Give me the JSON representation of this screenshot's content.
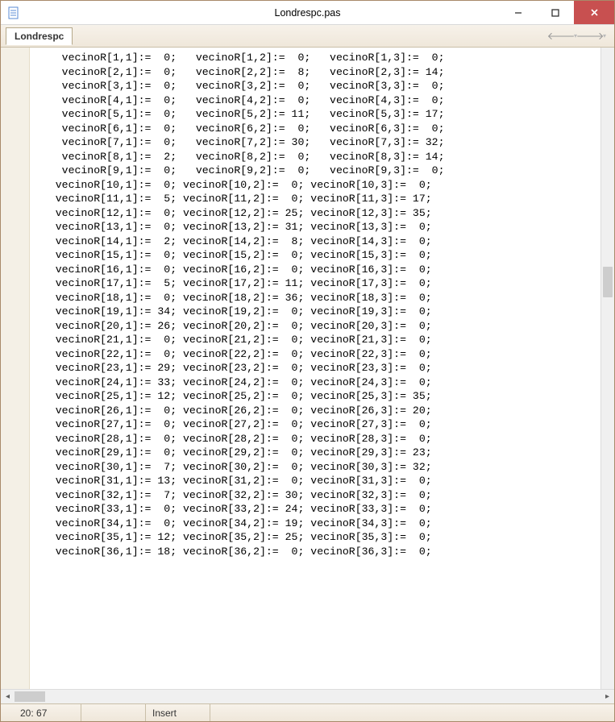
{
  "window": {
    "title": "Londrespc.pas"
  },
  "tab": {
    "label": "Londrespc"
  },
  "status": {
    "position": "20: 67",
    "mode": "Insert"
  },
  "code": {
    "indent": "   ",
    "rows": [
      {
        "i": 1,
        "a": 0,
        "b": 0,
        "c": 0
      },
      {
        "i": 2,
        "a": 0,
        "b": 8,
        "c": 14
      },
      {
        "i": 3,
        "a": 0,
        "b": 0,
        "c": 0
      },
      {
        "i": 4,
        "a": 0,
        "b": 0,
        "c": 0
      },
      {
        "i": 5,
        "a": 0,
        "b": 11,
        "c": 17
      },
      {
        "i": 6,
        "a": 0,
        "b": 0,
        "c": 0
      },
      {
        "i": 7,
        "a": 0,
        "b": 30,
        "c": 32
      },
      {
        "i": 8,
        "a": 2,
        "b": 0,
        "c": 14
      },
      {
        "i": 9,
        "a": 0,
        "b": 0,
        "c": 0
      },
      {
        "i": 10,
        "a": 0,
        "b": 0,
        "c": 0
      },
      {
        "i": 11,
        "a": 5,
        "b": 0,
        "c": 17
      },
      {
        "i": 12,
        "a": 0,
        "b": 25,
        "c": 35
      },
      {
        "i": 13,
        "a": 0,
        "b": 31,
        "c": 0
      },
      {
        "i": 14,
        "a": 2,
        "b": 8,
        "c": 0
      },
      {
        "i": 15,
        "a": 0,
        "b": 0,
        "c": 0
      },
      {
        "i": 16,
        "a": 0,
        "b": 0,
        "c": 0
      },
      {
        "i": 17,
        "a": 5,
        "b": 11,
        "c": 0
      },
      {
        "i": 18,
        "a": 0,
        "b": 36,
        "c": 0
      },
      {
        "i": 19,
        "a": 34,
        "b": 0,
        "c": 0
      },
      {
        "i": 20,
        "a": 26,
        "b": 0,
        "c": 0
      },
      {
        "i": 21,
        "a": 0,
        "b": 0,
        "c": 0
      },
      {
        "i": 22,
        "a": 0,
        "b": 0,
        "c": 0
      },
      {
        "i": 23,
        "a": 29,
        "b": 0,
        "c": 0
      },
      {
        "i": 24,
        "a": 33,
        "b": 0,
        "c": 0
      },
      {
        "i": 25,
        "a": 12,
        "b": 0,
        "c": 35
      },
      {
        "i": 26,
        "a": 0,
        "b": 0,
        "c": 20
      },
      {
        "i": 27,
        "a": 0,
        "b": 0,
        "c": 0
      },
      {
        "i": 28,
        "a": 0,
        "b": 0,
        "c": 0
      },
      {
        "i": 29,
        "a": 0,
        "b": 0,
        "c": 23
      },
      {
        "i": 30,
        "a": 7,
        "b": 0,
        "c": 32
      },
      {
        "i": 31,
        "a": 13,
        "b": 0,
        "c": 0
      },
      {
        "i": 32,
        "a": 7,
        "b": 30,
        "c": 0
      },
      {
        "i": 33,
        "a": 0,
        "b": 24,
        "c": 0
      },
      {
        "i": 34,
        "a": 0,
        "b": 19,
        "c": 0
      },
      {
        "i": 35,
        "a": 12,
        "b": 25,
        "c": 0
      },
      {
        "i": 36,
        "a": 18,
        "b": 0,
        "c": 0
      }
    ]
  }
}
